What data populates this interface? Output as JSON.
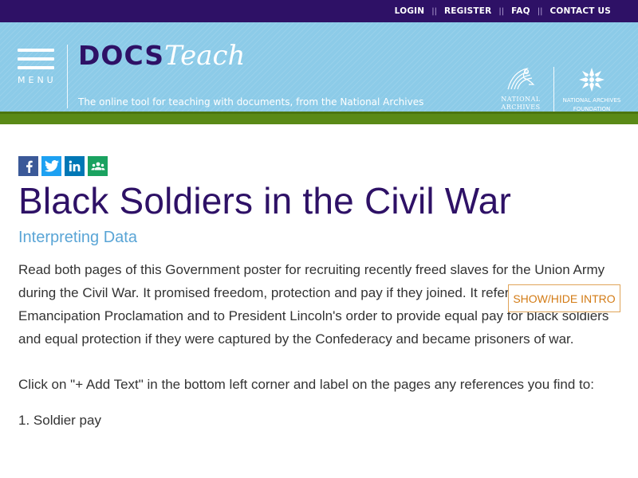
{
  "topnav": {
    "login": "LOGIN",
    "register": "REGISTER",
    "faq": "FAQ",
    "contact": "CONTACT US",
    "separator": "||"
  },
  "header": {
    "menu_label": "MENU",
    "logo_docs": "DOCS",
    "logo_teach": "Teach",
    "tagline": "The online tool for teaching with documents, from the National Archives",
    "na_logo_line1": "NATIONAL",
    "na_logo_line2": "ARCHIVES",
    "naf_logo_line1": "NATIONAL ARCHIVES",
    "naf_logo_line2": "FOUNDATION"
  },
  "share": {
    "facebook": "facebook-icon",
    "twitter": "twitter-icon",
    "linkedin": "linkedin-icon",
    "classroom": "google-classroom-icon"
  },
  "page": {
    "title": "Black Soldiers in the Civil War",
    "subtitle": "Interpreting Data",
    "toggle_label": "SHOW/HIDE INTRO",
    "intro_p1": "Read both pages of this Government poster for recruiting recently freed slaves for the Union Army during the Civil War. It promised freedom, protection and pay if they joined. It refers to the Emancipation Proclamation and to President Lincoln's order to provide equal pay for black soldiers and equal protection if they were captured by the Confederacy and became prisoners of war.",
    "intro_p2": "Click on \"+ Add Text\" in the bottom left corner and label on the pages any references you find to:",
    "list_items": [
      "1. Soldier pay"
    ]
  },
  "colors": {
    "topbar": "#2e1166",
    "header": "#8ccbe8",
    "green": "#5a8a17",
    "title": "#2e1166",
    "subtitle": "#5aa5d6",
    "button": "#d37b15"
  }
}
